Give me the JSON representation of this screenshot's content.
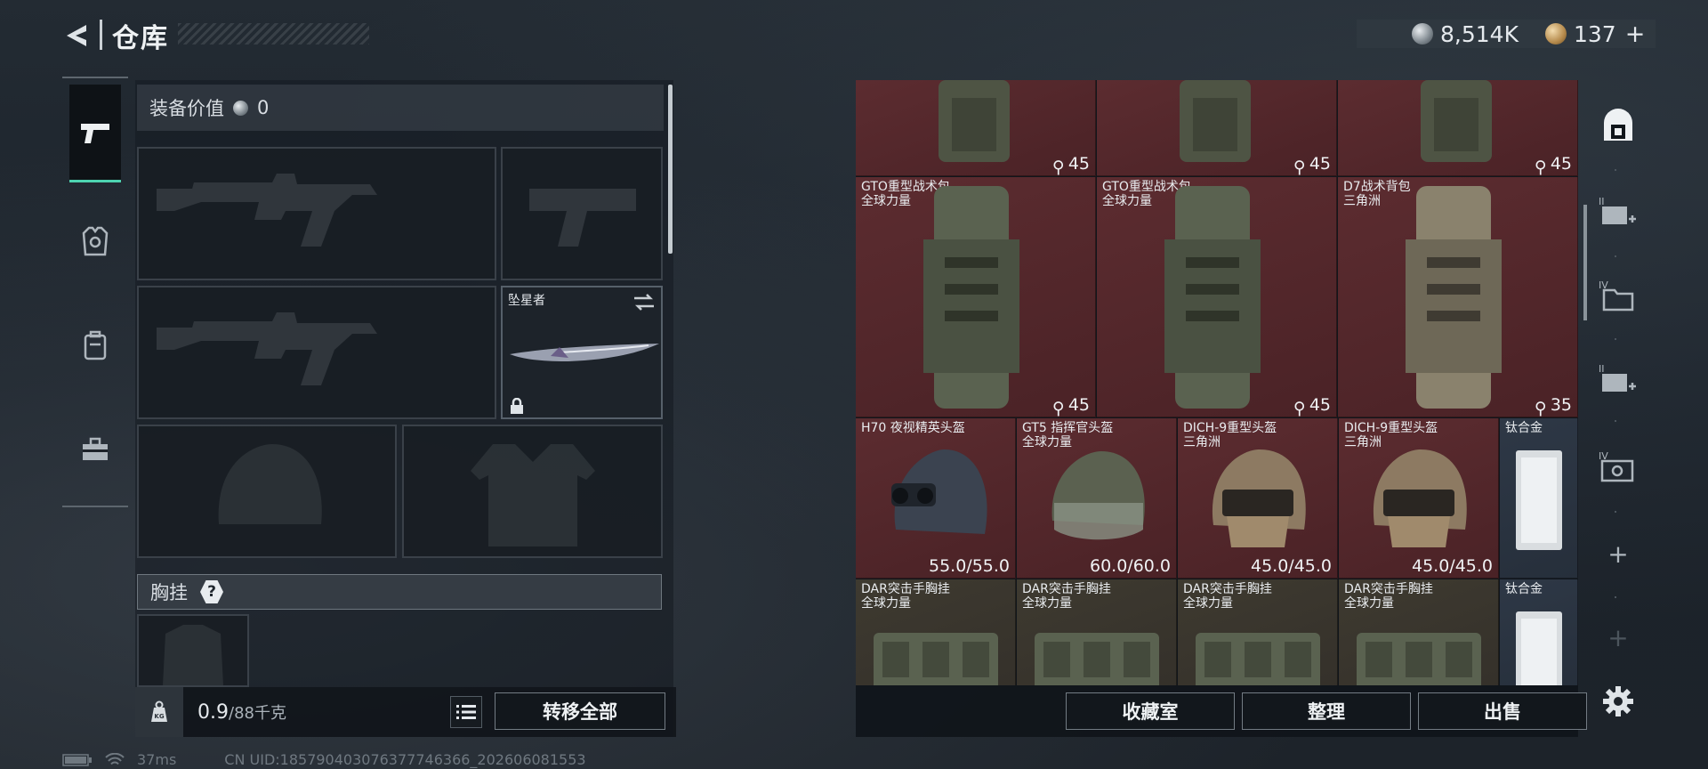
{
  "header": {
    "title": "仓库",
    "currencies": [
      {
        "icon": "silver-coin-icon",
        "value": "8,514K"
      },
      {
        "icon": "gold-coin-icon",
        "value": "137"
      }
    ],
    "add_label": "+"
  },
  "left_tabs": [
    {
      "name": "weapons",
      "icon": "pistol-icon",
      "active": true
    },
    {
      "name": "armor",
      "icon": "armor-vest-icon",
      "active": false
    },
    {
      "name": "backpack",
      "icon": "backpack-icon",
      "active": false
    },
    {
      "name": "toolbox",
      "icon": "toolbox-icon",
      "active": false
    }
  ],
  "loadout": {
    "equip_value_label": "装备价值",
    "equip_value": "0",
    "melee_name": "坠星者",
    "chest_rig_label": "胸挂",
    "help_label": "?",
    "weight_value": "0.9",
    "weight_max": "/88千克",
    "transfer_all_label": "转移全部"
  },
  "stash": {
    "rows": [
      [
        {
          "name": "",
          "sub": "",
          "count": "45"
        },
        {
          "name": "",
          "sub": "",
          "count": "45"
        },
        {
          "name": "",
          "sub": "",
          "count": "45"
        }
      ],
      [
        {
          "name": "GTO重型战术包",
          "sub": "全球力量",
          "count": "45"
        },
        {
          "name": "GTO重型战术包",
          "sub": "全球力量",
          "count": "45"
        },
        {
          "name": "D7战术背包",
          "sub": "三角洲",
          "count": "35"
        }
      ],
      [
        {
          "name": "H70 夜视精英头盔",
          "sub": "",
          "durability": "55.0/55.0"
        },
        {
          "name": "GT5 指挥官头盔",
          "sub": "全球力量",
          "durability": "60.0/60.0"
        },
        {
          "name": "DICH-9重型头盔",
          "sub": "三角洲",
          "durability": "45.0/45.0"
        },
        {
          "name": "DICH-9重型头盔",
          "sub": "三角洲",
          "durability": "45.0/45.0"
        },
        {
          "name": "钛合金",
          "sub": ""
        }
      ],
      [
        {
          "name": "DAR突击手胸挂",
          "sub": "全球力量"
        },
        {
          "name": "DAR突击手胸挂",
          "sub": "全球力量"
        },
        {
          "name": "DAR突击手胸挂",
          "sub": "全球力量"
        },
        {
          "name": "DAR突击手胸挂",
          "sub": "全球力量"
        },
        {
          "name": "钛合金",
          "sub": ""
        }
      ]
    ],
    "buttons": {
      "collection": "收藏室",
      "organize": "整理",
      "sell": "出售"
    }
  },
  "right_tabs": [
    {
      "icon": "safe-house-icon",
      "label": ""
    },
    {
      "icon": "storage-expand-icon",
      "label": "II"
    },
    {
      "icon": "storage-folder-icon",
      "label": "IV"
    },
    {
      "icon": "storage-expand-icon",
      "label": "II"
    },
    {
      "icon": "storage-case-icon",
      "label": "IV"
    },
    {
      "icon": "add-icon",
      "label": "+"
    },
    {
      "icon": "add-icon",
      "label": "+"
    }
  ],
  "status": {
    "ping": "37ms",
    "uid": "CN UID:1857904030763777463​66_202606081553"
  }
}
